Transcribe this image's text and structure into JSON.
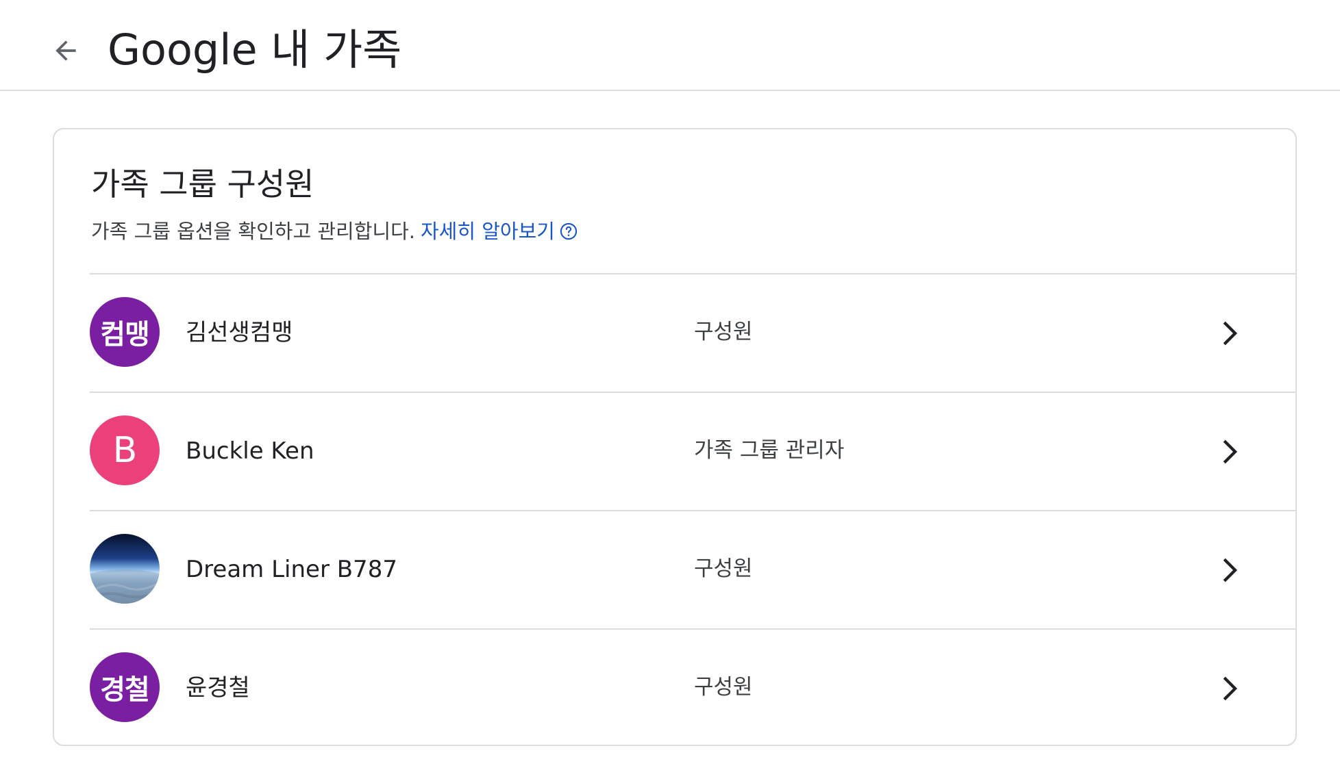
{
  "header": {
    "title": "Google 내 가족",
    "back_icon": "arrow-back-icon"
  },
  "card": {
    "title": "가족 그룹 구성원",
    "description": "가족 그룹 옵션을 확인하고 관리합니다.",
    "learn_more": "자세히 알아보기",
    "help_icon": "help-circle-icon"
  },
  "members": [
    {
      "name": "김선생컴맹",
      "role": "구성원",
      "avatar_text": "컴맹",
      "avatar_color": "#7b1fa2",
      "avatar_type": "text"
    },
    {
      "name": "Buckle Ken",
      "role": "가족 그룹 관리자",
      "avatar_text": "B",
      "avatar_color": "#ec407a",
      "avatar_type": "letter"
    },
    {
      "name": "Dream Liner B787",
      "role": "구성원",
      "avatar_text": "",
      "avatar_color": "#3f6fb0",
      "avatar_type": "photo"
    },
    {
      "name": "윤경철",
      "role": "구성원",
      "avatar_text": "경철",
      "avatar_color": "#7b1fa2",
      "avatar_type": "text"
    }
  ],
  "colors": {
    "link": "#1a56c8",
    "divider": "#dadce0"
  }
}
